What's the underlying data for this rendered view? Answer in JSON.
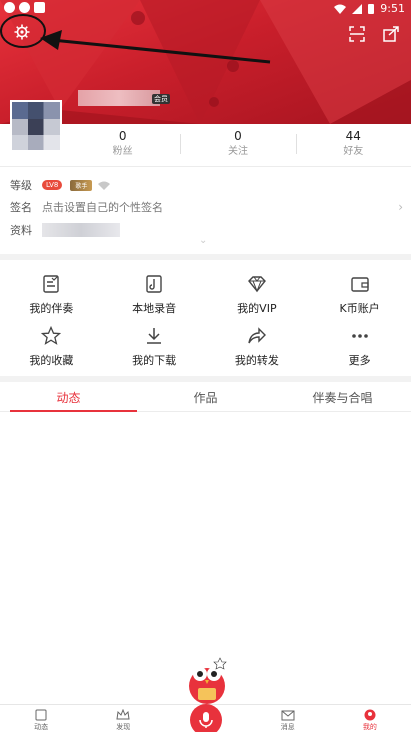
{
  "status_bar": {
    "time": "9:51"
  },
  "profile": {
    "nickname_tag": "会员"
  },
  "stats": [
    {
      "value": "0",
      "label": "粉丝"
    },
    {
      "value": "0",
      "label": "关注"
    },
    {
      "value": "44",
      "label": "好友"
    }
  ],
  "info": {
    "level_key": "等级",
    "level_badge": "LV8",
    "level_badge2": "歌手",
    "signature_key": "签名",
    "signature_value": "点击设置自己的个性签名",
    "profile_key": "资料"
  },
  "grid_row1": [
    {
      "label": "我的伴奏",
      "icon": "accompaniment-icon"
    },
    {
      "label": "本地录音",
      "icon": "local-recording-icon"
    },
    {
      "label": "我的VIP",
      "icon": "vip-diamond-icon"
    },
    {
      "label": "K币账户",
      "icon": "wallet-icon"
    }
  ],
  "grid_row2": [
    {
      "label": "我的收藏",
      "icon": "star-icon"
    },
    {
      "label": "我的下载",
      "icon": "download-icon"
    },
    {
      "label": "我的转发",
      "icon": "share-icon"
    },
    {
      "label": "更多",
      "icon": "more-icon"
    }
  ],
  "tabs": [
    {
      "label": "动态",
      "active": true
    },
    {
      "label": "作品",
      "active": false
    },
    {
      "label": "伴奏与合唱",
      "active": false
    }
  ],
  "bottom_nav": [
    {
      "label": "动态"
    },
    {
      "label": "发现"
    },
    {
      "label": "消息"
    },
    {
      "label": "我的"
    }
  ],
  "colors": {
    "accent": "#e8323c",
    "header": "#c91f2b"
  }
}
